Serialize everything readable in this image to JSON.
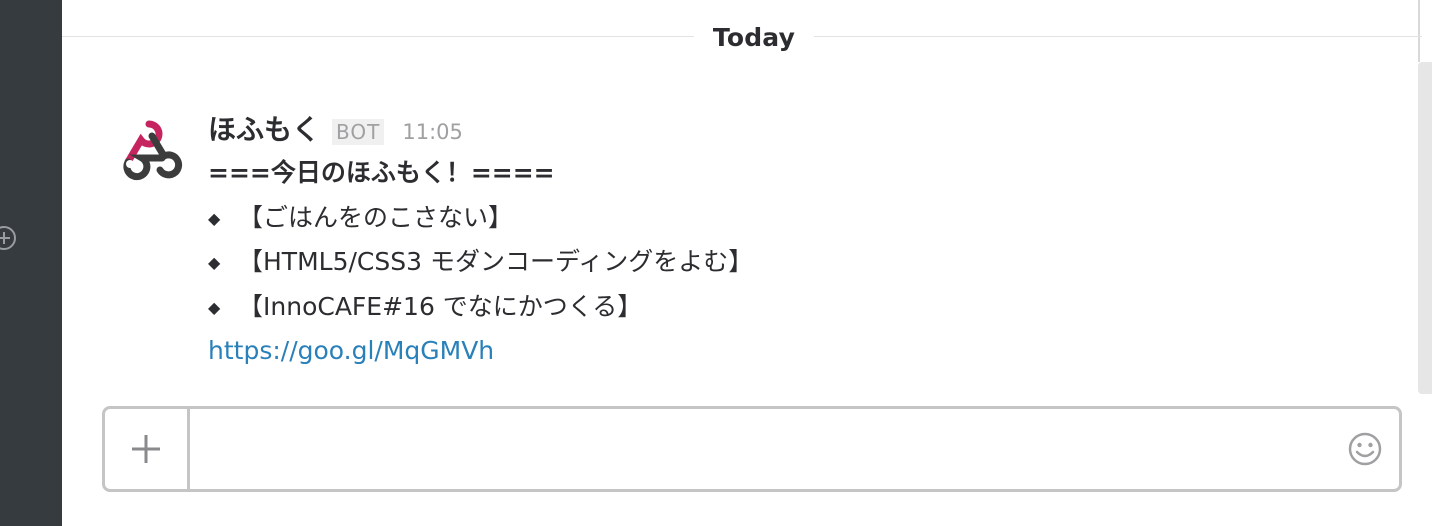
{
  "divider": {
    "label": "Today"
  },
  "message": {
    "sender": "ほふもく",
    "badge": "BOT",
    "time": "11:05",
    "lines": [
      "===今日のほふもく！====",
      "【ごはんをのこさない】",
      "【HTML5/CSS3 モダンコーディングをよむ】",
      "【InnoCAFE#16 でなにかつくる】"
    ],
    "bullet": "◆",
    "link": "https://goo.gl/MqGMVh"
  },
  "composer": {
    "value": "",
    "plus_icon": "plus-icon",
    "emoji_icon": "smiley-icon"
  },
  "colors": {
    "sidebar": "#363b40",
    "link": "#2a80b9",
    "avatar_accent": "#c6245e",
    "avatar_dark": "#3c3c3c"
  }
}
